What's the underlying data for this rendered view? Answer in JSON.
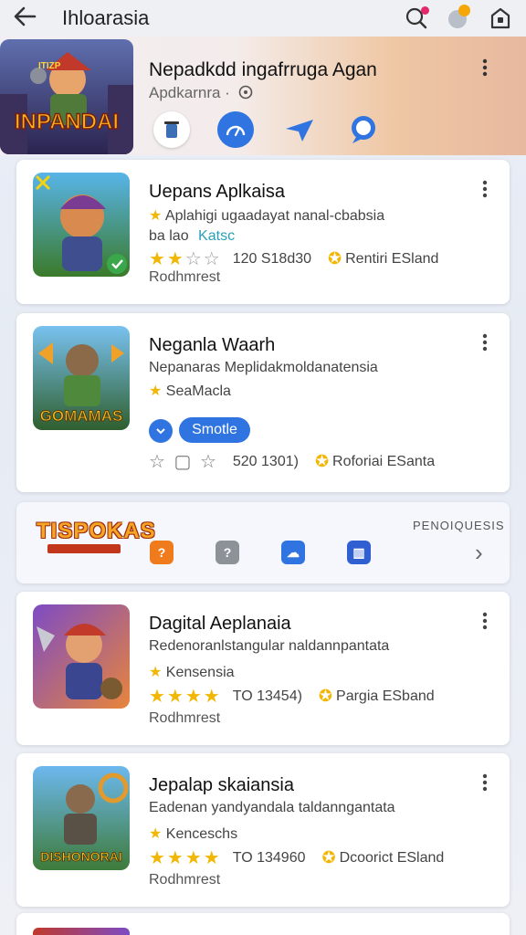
{
  "header": {
    "back_icon": "arrow-left-icon",
    "title": "Ihloarasia"
  },
  "featured": {
    "title": "Nepadkdd ingafrruga Agan",
    "subtitle": "Apdkarnra ·",
    "thumb_text": "INPANDAI",
    "thumb_top_text": "ITIZP"
  },
  "cards": [
    {
      "title": "Uepans Aplkaisa",
      "desc": "Aplahigi ugaadayat nanal-cbabsia",
      "tag_prefix": "ba lao",
      "tag": "Katsc",
      "rating": "120 S18d30",
      "badge": "Rentiri ESland",
      "extra": "Rodhmrest"
    },
    {
      "title": "Neganla Waarh",
      "desc": "Nepanaras Meplidakmoldanatensia",
      "genre": "SeaMacla",
      "pill": "Smotle",
      "rating": "520 1301)",
      "badge": "Roforiai ESanta",
      "thumb_text": "GOMAMAS"
    },
    {
      "title": "Dagital Aeplanaia",
      "desc": "Redenoranlstangular naldannpantata",
      "genre": "Kensensia",
      "rating": "TO 13454)",
      "badge": "Pargia ESband",
      "extra": "Rodhmrest"
    },
    {
      "title": "Jepalap skaiansia",
      "desc": "Eadenan yandyandala taldanngantata",
      "genre": "Kenceschs",
      "rating": "TO 134960",
      "badge": "Dcoorict ESland",
      "extra": "Rodhmrest",
      "thumb_text": "DISHONORAI"
    }
  ],
  "promo": {
    "logo": "TISPOKAS",
    "label": "PENOIQUESIS"
  },
  "colors": {
    "accent": "#2f74e0",
    "star": "#f2b705"
  }
}
